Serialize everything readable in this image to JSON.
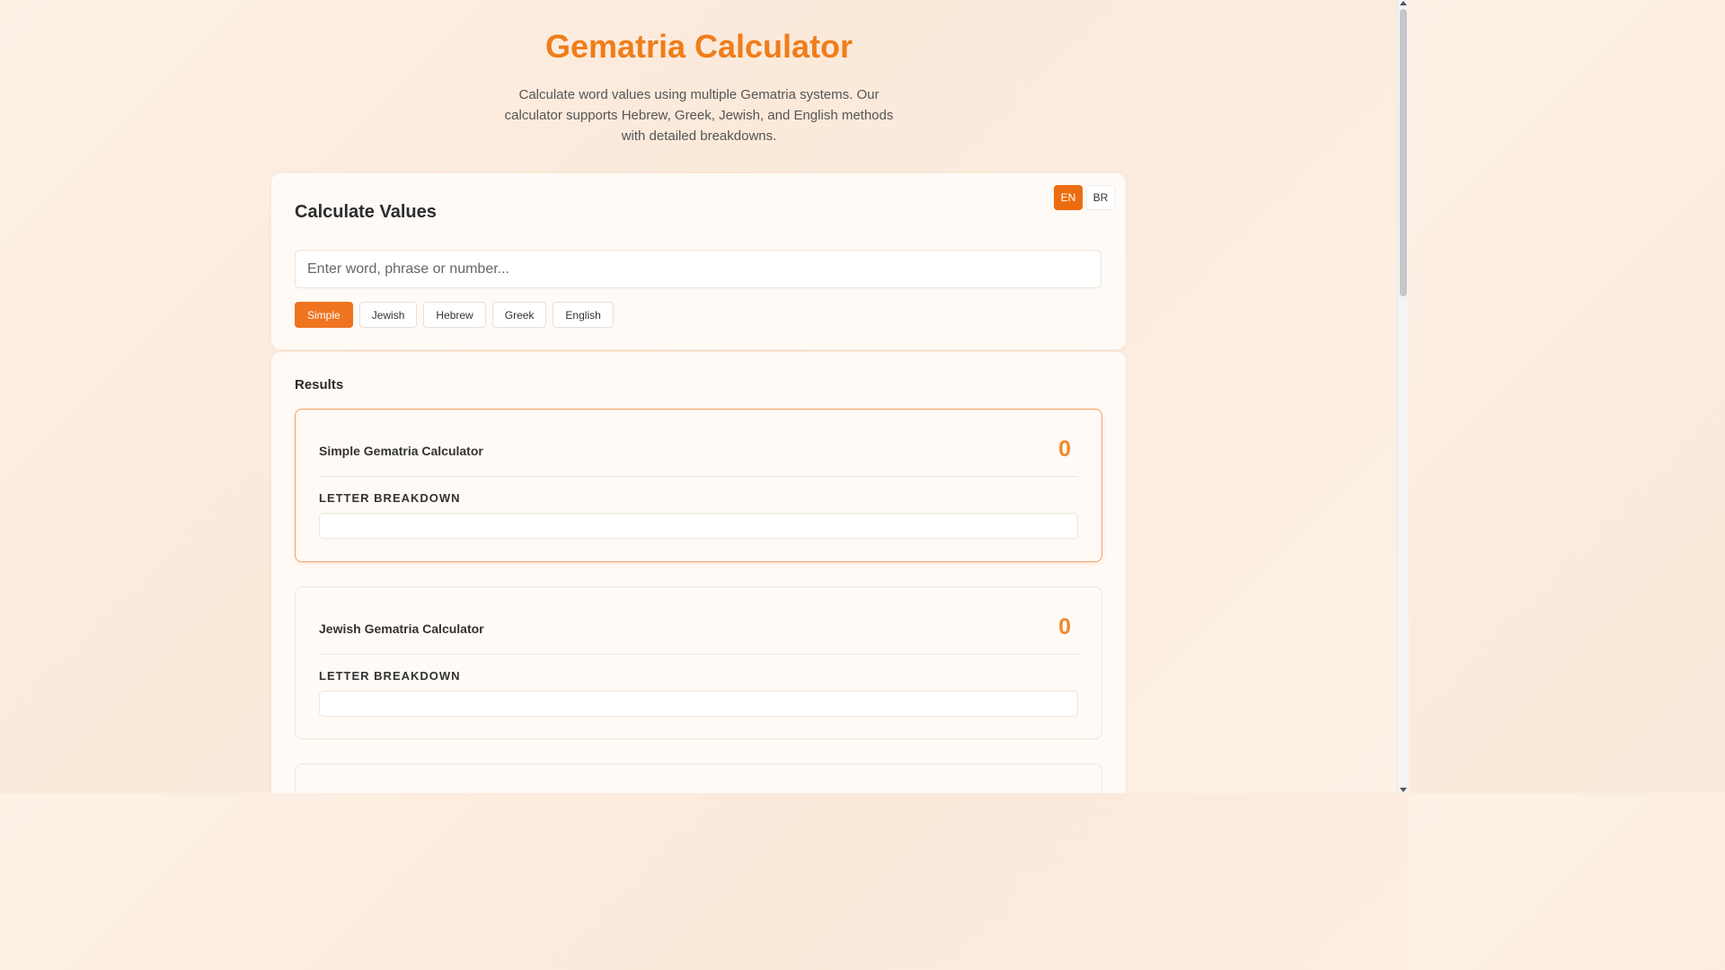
{
  "header": {
    "title": "Gematria Calculator",
    "subtitle": "Calculate word values using multiple Gematria systems. Our calculator supports Hebrew, Greek, Jewish, and English methods with detailed breakdowns."
  },
  "calculator": {
    "title": "Calculate Values",
    "languages": [
      "EN",
      "BR"
    ],
    "active_language": "EN",
    "input": {
      "placeholder": "Enter word, phrase or number...",
      "value": ""
    },
    "methods": [
      "Simple",
      "Jewish",
      "Hebrew",
      "Greek",
      "English"
    ],
    "active_method": "Simple"
  },
  "results": {
    "title": "Results",
    "items": [
      {
        "name": "Simple Gematria Calculator",
        "value": "0",
        "breakdown_label": "LETTER BREAKDOWN"
      },
      {
        "name": "Jewish Gematria Calculator",
        "value": "0",
        "breakdown_label": "LETTER BREAKDOWN"
      }
    ]
  },
  "colors": {
    "accent": "#ef7420",
    "title": "#f07d1a",
    "value": "#f08a2c"
  }
}
